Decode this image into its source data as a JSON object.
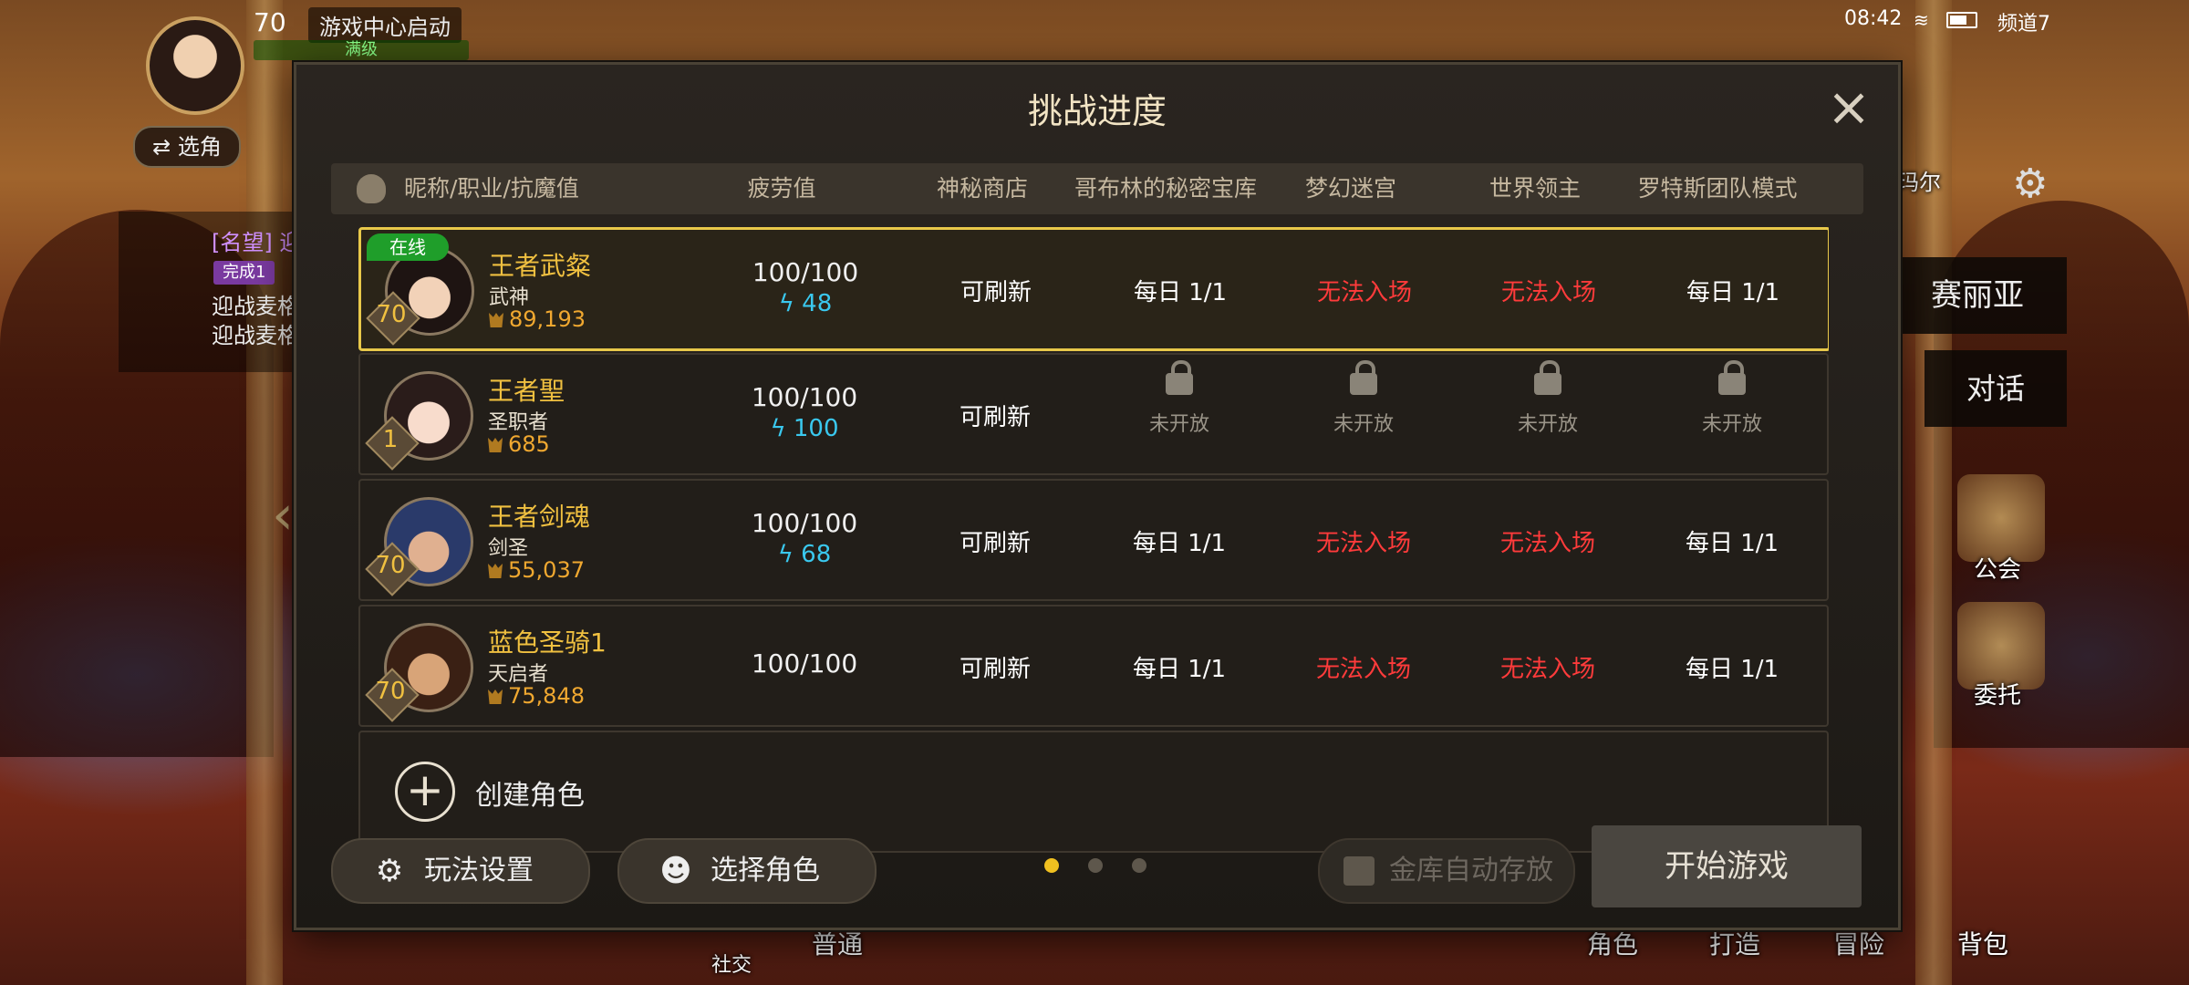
{
  "hud": {
    "level": "70",
    "notice": "游戏中心启动",
    "full_label": "满级",
    "switch_role": "⇄ 选角",
    "quest_title": "[名望] 迎",
    "quest_done": "完成1",
    "quest_line1": "迎战麦格",
    "quest_line2": "迎战麦格"
  },
  "status": {
    "time": "08:42",
    "channel": "频道7"
  },
  "npc": {
    "name": "赛丽亚",
    "talk": "对话",
    "partial_text": "玛尔"
  },
  "side": {
    "guild": "公会",
    "commission": "委托"
  },
  "bottom_bar": [
    "社交",
    "普通",
    "角色",
    "打造",
    "冒险",
    "背包"
  ],
  "modal": {
    "title": "挑战进度",
    "columns": [
      "昵称/职业/抗魔值",
      "疲劳值",
      "神秘商店",
      "哥布林的秘密宝库",
      "梦幻迷宫",
      "世界领主",
      "罗特斯团队模式"
    ],
    "characters": [
      {
        "online": "在线",
        "level": "70",
        "name": "王者武粲",
        "job": "武神",
        "power": "89,193",
        "fatigue": "100/100",
        "energy": "48",
        "shop": "可刷新",
        "goblin": "每日 1/1",
        "maze": "无法入场",
        "lord": "无法入场",
        "raid": "每日 1/1"
      },
      {
        "level": "1",
        "name": "王者聖",
        "job": "圣职者",
        "power": "685",
        "fatigue": "100/100",
        "energy": "100",
        "shop": "可刷新",
        "locked_text": "未开放"
      },
      {
        "level": "70",
        "name": "王者剑魂",
        "job": "剑圣",
        "power": "55,037",
        "fatigue": "100/100",
        "energy": "68",
        "shop": "可刷新",
        "goblin": "每日 1/1",
        "maze": "无法入场",
        "lord": "无法入场",
        "raid": "每日 1/1"
      },
      {
        "level": "70",
        "name": "蓝色圣骑1",
        "job": "天启者",
        "power": "75,848",
        "fatigue": "100/100",
        "shop": "可刷新",
        "goblin": "每日 1/1",
        "maze": "无法入场",
        "lord": "无法入场",
        "raid": "每日 1/1"
      }
    ],
    "create_role": "创建角色",
    "play_settings": "玩法设置",
    "select_role": "选择角色",
    "vault_auto": "金库自动存放",
    "start_game": "开始游戏",
    "page_count": 3,
    "active_page": 1
  },
  "colors": {
    "gold": "#f0c040",
    "red": "#ff3b3b",
    "energy": "#3ac8ee",
    "online": "#1f9e2a"
  }
}
